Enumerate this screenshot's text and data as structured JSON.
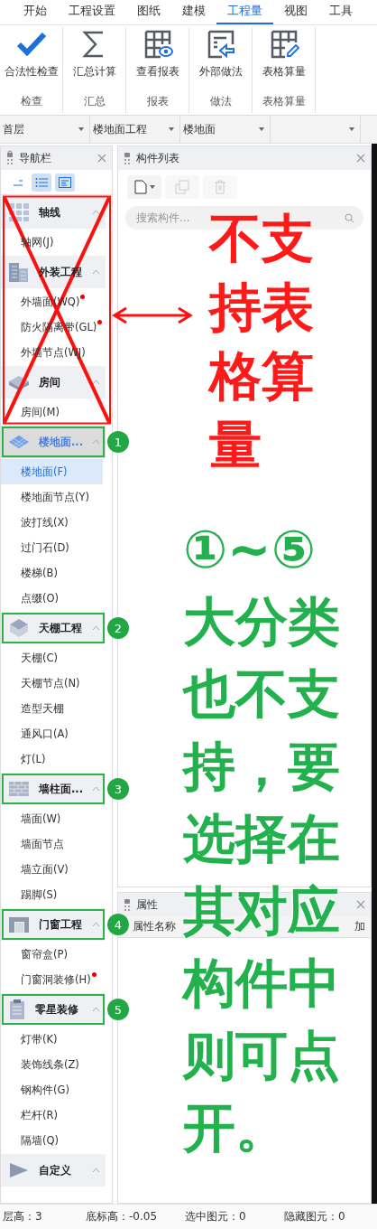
{
  "ribbon_tabs": [
    {
      "label": "开始",
      "selected": false
    },
    {
      "label": "工程设置",
      "selected": false
    },
    {
      "label": "图纸",
      "selected": false
    },
    {
      "label": "建模",
      "selected": false
    },
    {
      "label": "工程量",
      "selected": true
    },
    {
      "label": "视图",
      "selected": false
    },
    {
      "label": "工具",
      "selected": false
    }
  ],
  "ribbon_groups": [
    {
      "kind": "check",
      "button": "合法性检查",
      "label": "检查"
    },
    {
      "kind": "sum",
      "button": "汇总计算",
      "label": "汇总"
    },
    {
      "kind": "report",
      "button": "查看报表",
      "label": "报表"
    },
    {
      "kind": "import",
      "button": "外部做法",
      "label": "做法"
    },
    {
      "kind": "table",
      "button": "表格算量",
      "label": "表格算量"
    }
  ],
  "selectors": [
    {
      "kind": "dropdown",
      "value": "首层"
    },
    {
      "kind": "dropdown",
      "value": "楼地面工程"
    },
    {
      "kind": "dropdown",
      "value": "楼地面"
    },
    {
      "kind": "dropdown"
    }
  ],
  "navigation": {
    "title": "导航栏",
    "sections": [
      {
        "crossed": true,
        "categories": [
          {
            "kind": "grid",
            "label": "轴线",
            "expanded": true,
            "selected": false,
            "items": [
              {
                "label": "轴网(J)",
                "selected": false,
                "flagged": false
              }
            ]
          },
          {
            "kind": "building",
            "label": "外装工程",
            "expanded": true,
            "selected": false,
            "items": [
              {
                "label": "外墙面(WQ)",
                "selected": false,
                "flagged": true
              },
              {
                "label": "防火隔离带(GL)",
                "selected": false,
                "flagged": true
              },
              {
                "label": "外墙节点(WJ)",
                "selected": false,
                "flagged": false
              }
            ]
          },
          {
            "kind": "room",
            "label": "房间",
            "expanded": true,
            "selected": false,
            "items": [
              {
                "label": "房间(M)",
                "selected": false,
                "flagged": false
              }
            ]
          }
        ]
      },
      {
        "categories": [
          {
            "kind": "floor",
            "label": "楼地面...",
            "expanded": true,
            "selected": true,
            "callout": "1",
            "items": [
              {
                "label": "楼地面(F)",
                "selected": true,
                "flagged": false
              },
              {
                "label": "楼地面节点(Y)",
                "selected": false,
                "flagged": false
              },
              {
                "label": "波打线(X)",
                "selected": false,
                "flagged": false
              },
              {
                "label": "过门石(D)",
                "selected": false,
                "flagged": false
              },
              {
                "label": "楼梯(B)",
                "selected": false,
                "flagged": false
              },
              {
                "label": "点缀(O)",
                "selected": false,
                "flagged": false
              }
            ]
          },
          {
            "kind": "ceiling",
            "label": "天棚工程",
            "expanded": true,
            "selected": false,
            "callout": "2",
            "items": [
              {
                "label": "天棚(C)",
                "selected": false,
                "flagged": false
              },
              {
                "label": "天棚节点(N)",
                "selected": false,
                "flagged": false
              },
              {
                "label": "造型天棚",
                "selected": false,
                "flagged": false
              },
              {
                "label": "通风口(A)",
                "selected": false,
                "flagged": false
              },
              {
                "label": "灯(L)",
                "selected": false,
                "flagged": false
              }
            ]
          },
          {
            "kind": "wall",
            "label": "墙柱面...",
            "expanded": true,
            "selected": false,
            "callout": "3",
            "items": [
              {
                "label": "墙面(W)",
                "selected": false,
                "flagged": false
              },
              {
                "label": "墙面节点",
                "selected": false,
                "flagged": false
              },
              {
                "label": "墙立面(V)",
                "selected": false,
                "flagged": false
              },
              {
                "label": "踢脚(S)",
                "selected": false,
                "flagged": false
              }
            ]
          },
          {
            "kind": "door",
            "label": "门窗工程",
            "expanded": true,
            "selected": false,
            "callout": "4",
            "items": [
              {
                "label": "窗帘盒(P)",
                "selected": false,
                "flagged": false
              },
              {
                "label": "门窗洞装修(H)",
                "selected": false,
                "flagged": true
              }
            ]
          },
          {
            "kind": "misc",
            "label": "零星装修",
            "expanded": true,
            "selected": false,
            "callout": "5",
            "items": [
              {
                "label": "灯带(K)",
                "selected": false,
                "flagged": false
              },
              {
                "label": "装饰线条(Z)",
                "selected": false,
                "flagged": false
              },
              {
                "label": "钢构件(G)",
                "selected": false,
                "flagged": false
              },
              {
                "label": "栏杆(R)",
                "selected": false,
                "flagged": false
              },
              {
                "label": "隔墙(Q)",
                "selected": false,
                "flagged": false
              }
            ]
          },
          {
            "kind": "custom",
            "label": "自定义",
            "expanded": true,
            "selected": false
          }
        ]
      }
    ]
  },
  "component_list": {
    "title": "构件列表",
    "search": {
      "placeholder": "搜索构件..."
    }
  },
  "properties": {
    "title": "属性",
    "column_1": "属性名称",
    "column_3": "加"
  },
  "status_bar": [
    "层高：3",
    "底标高：-0.05",
    "选中图元：0",
    "隐藏图元：0"
  ],
  "annotations": {
    "red_note": "不支持表格算量",
    "green_note": "①~⑤大分类也不支持，要选择在其对应构件中则可点开。"
  }
}
